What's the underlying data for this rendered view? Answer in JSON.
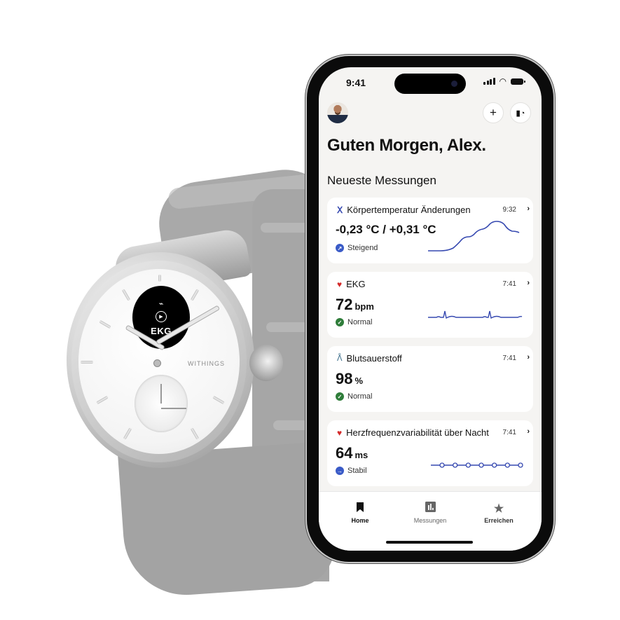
{
  "watch": {
    "brand": "WITHINGS",
    "screen": {
      "icon": "ecg-wave-icon",
      "play_icon": "play-icon",
      "label": "EKG"
    }
  },
  "phone": {
    "status_bar": {
      "time": "9:41",
      "icons": [
        "signal-icon",
        "wifi-icon",
        "battery-icon"
      ]
    },
    "header": {
      "avatar": "user-avatar",
      "add_button": "+",
      "device_button": "▮◔"
    },
    "greeting": "Guten Morgen, Alex.",
    "section_title": "Neueste Messungen",
    "cards": [
      {
        "title": "Körpertemperatur Änderungen",
        "icon": "body-temperature-icon",
        "time": "9:32",
        "value": "-0,23 °C / +0,31 °C",
        "unit": "",
        "status": "Steigend",
        "status_icon": "trend-up-icon",
        "status_color": "#3a5bc7",
        "chart": "temperature-curve"
      },
      {
        "title": "EKG",
        "icon": "heart-icon",
        "time": "7:41",
        "value": "72",
        "unit": "bpm",
        "status": "Normal",
        "status_icon": "check-icon",
        "status_color": "#2f7d3a",
        "chart": "ecg-trace"
      },
      {
        "title": "Blutsauerstoff",
        "icon": "lungs-icon",
        "time": "7:41",
        "value": "98",
        "unit": "%",
        "status": "Normal",
        "status_icon": "check-icon",
        "status_color": "#2f7d3a"
      },
      {
        "title": "Herzfrequenzvariabilität über Nacht",
        "icon": "heart-icon",
        "time": "7:41",
        "value": "64",
        "unit": "ms",
        "status": "Stabil",
        "status_icon": "arrow-right-icon",
        "status_color": "#3a5bc7",
        "chart": "hrv-dots",
        "hrv_points": 7
      }
    ],
    "tabs": [
      {
        "label": "Home",
        "icon": "home-bookmark-icon",
        "active": true
      },
      {
        "label": "Messungen",
        "icon": "bar-chart-icon",
        "active": false
      },
      {
        "label": "Erreichen",
        "icon": "star-icon",
        "active": false
      }
    ],
    "colors": {
      "accent": "#3548b0",
      "heart": "#d42a2a",
      "background": "#f5f4f2"
    }
  }
}
